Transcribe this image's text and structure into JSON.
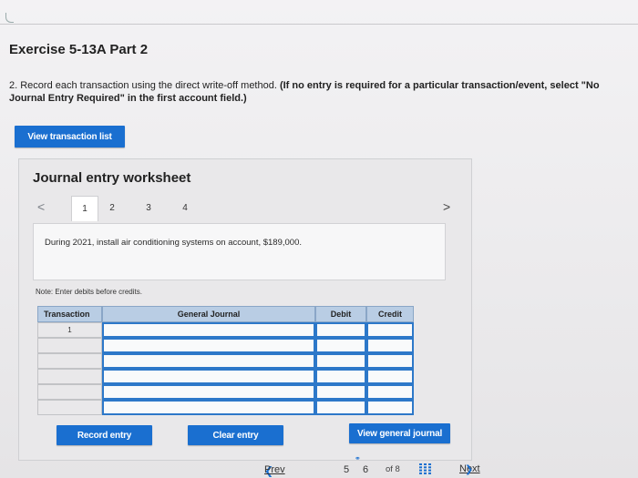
{
  "exercise": {
    "title": "Exercise 5-13A Part 2"
  },
  "instruction": {
    "lead": "2. Record each transaction using the direct write-off method. ",
    "emphasis": "(If no entry is required for a particular transaction/event, select \"No Journal Entry Required\" in the first account field.)"
  },
  "buttons": {
    "view_transaction_list": "View transaction list",
    "record_entry": "Record entry",
    "clear_entry": "Clear entry",
    "view_general_journal": "View general journal"
  },
  "worksheet": {
    "title": "Journal entry worksheet",
    "prev_arrow": "<",
    "next_arrow": ">",
    "pages": [
      "1",
      "2",
      "3",
      "4"
    ],
    "active_page": "1",
    "description": "During 2021, install air conditioning systems on account, $189,000.",
    "note": "Note: Enter debits before credits."
  },
  "journal_table": {
    "headers": {
      "transaction": "Transaction",
      "account": "General Journal",
      "debit": "Debit",
      "credit": "Credit"
    },
    "rows": [
      {
        "transaction": "1",
        "account": "",
        "debit": "",
        "credit": ""
      },
      {
        "transaction": "",
        "account": "",
        "debit": "",
        "credit": ""
      },
      {
        "transaction": "",
        "account": "",
        "debit": "",
        "credit": ""
      },
      {
        "transaction": "",
        "account": "",
        "debit": "",
        "credit": ""
      },
      {
        "transaction": "",
        "account": "",
        "debit": "",
        "credit": ""
      },
      {
        "transaction": "",
        "account": "",
        "debit": "",
        "credit": ""
      }
    ]
  },
  "pagination": {
    "prev_label": "Prev",
    "current_pages": [
      "5",
      "6"
    ],
    "of_label": "of 8",
    "next_label": "Next",
    "icons": [
      "link-icon",
      "grid-icon"
    ]
  },
  "colors": {
    "primary_button": "#1a6fd0",
    "table_header": "#b9cde4",
    "input_border": "#2d78c9"
  }
}
